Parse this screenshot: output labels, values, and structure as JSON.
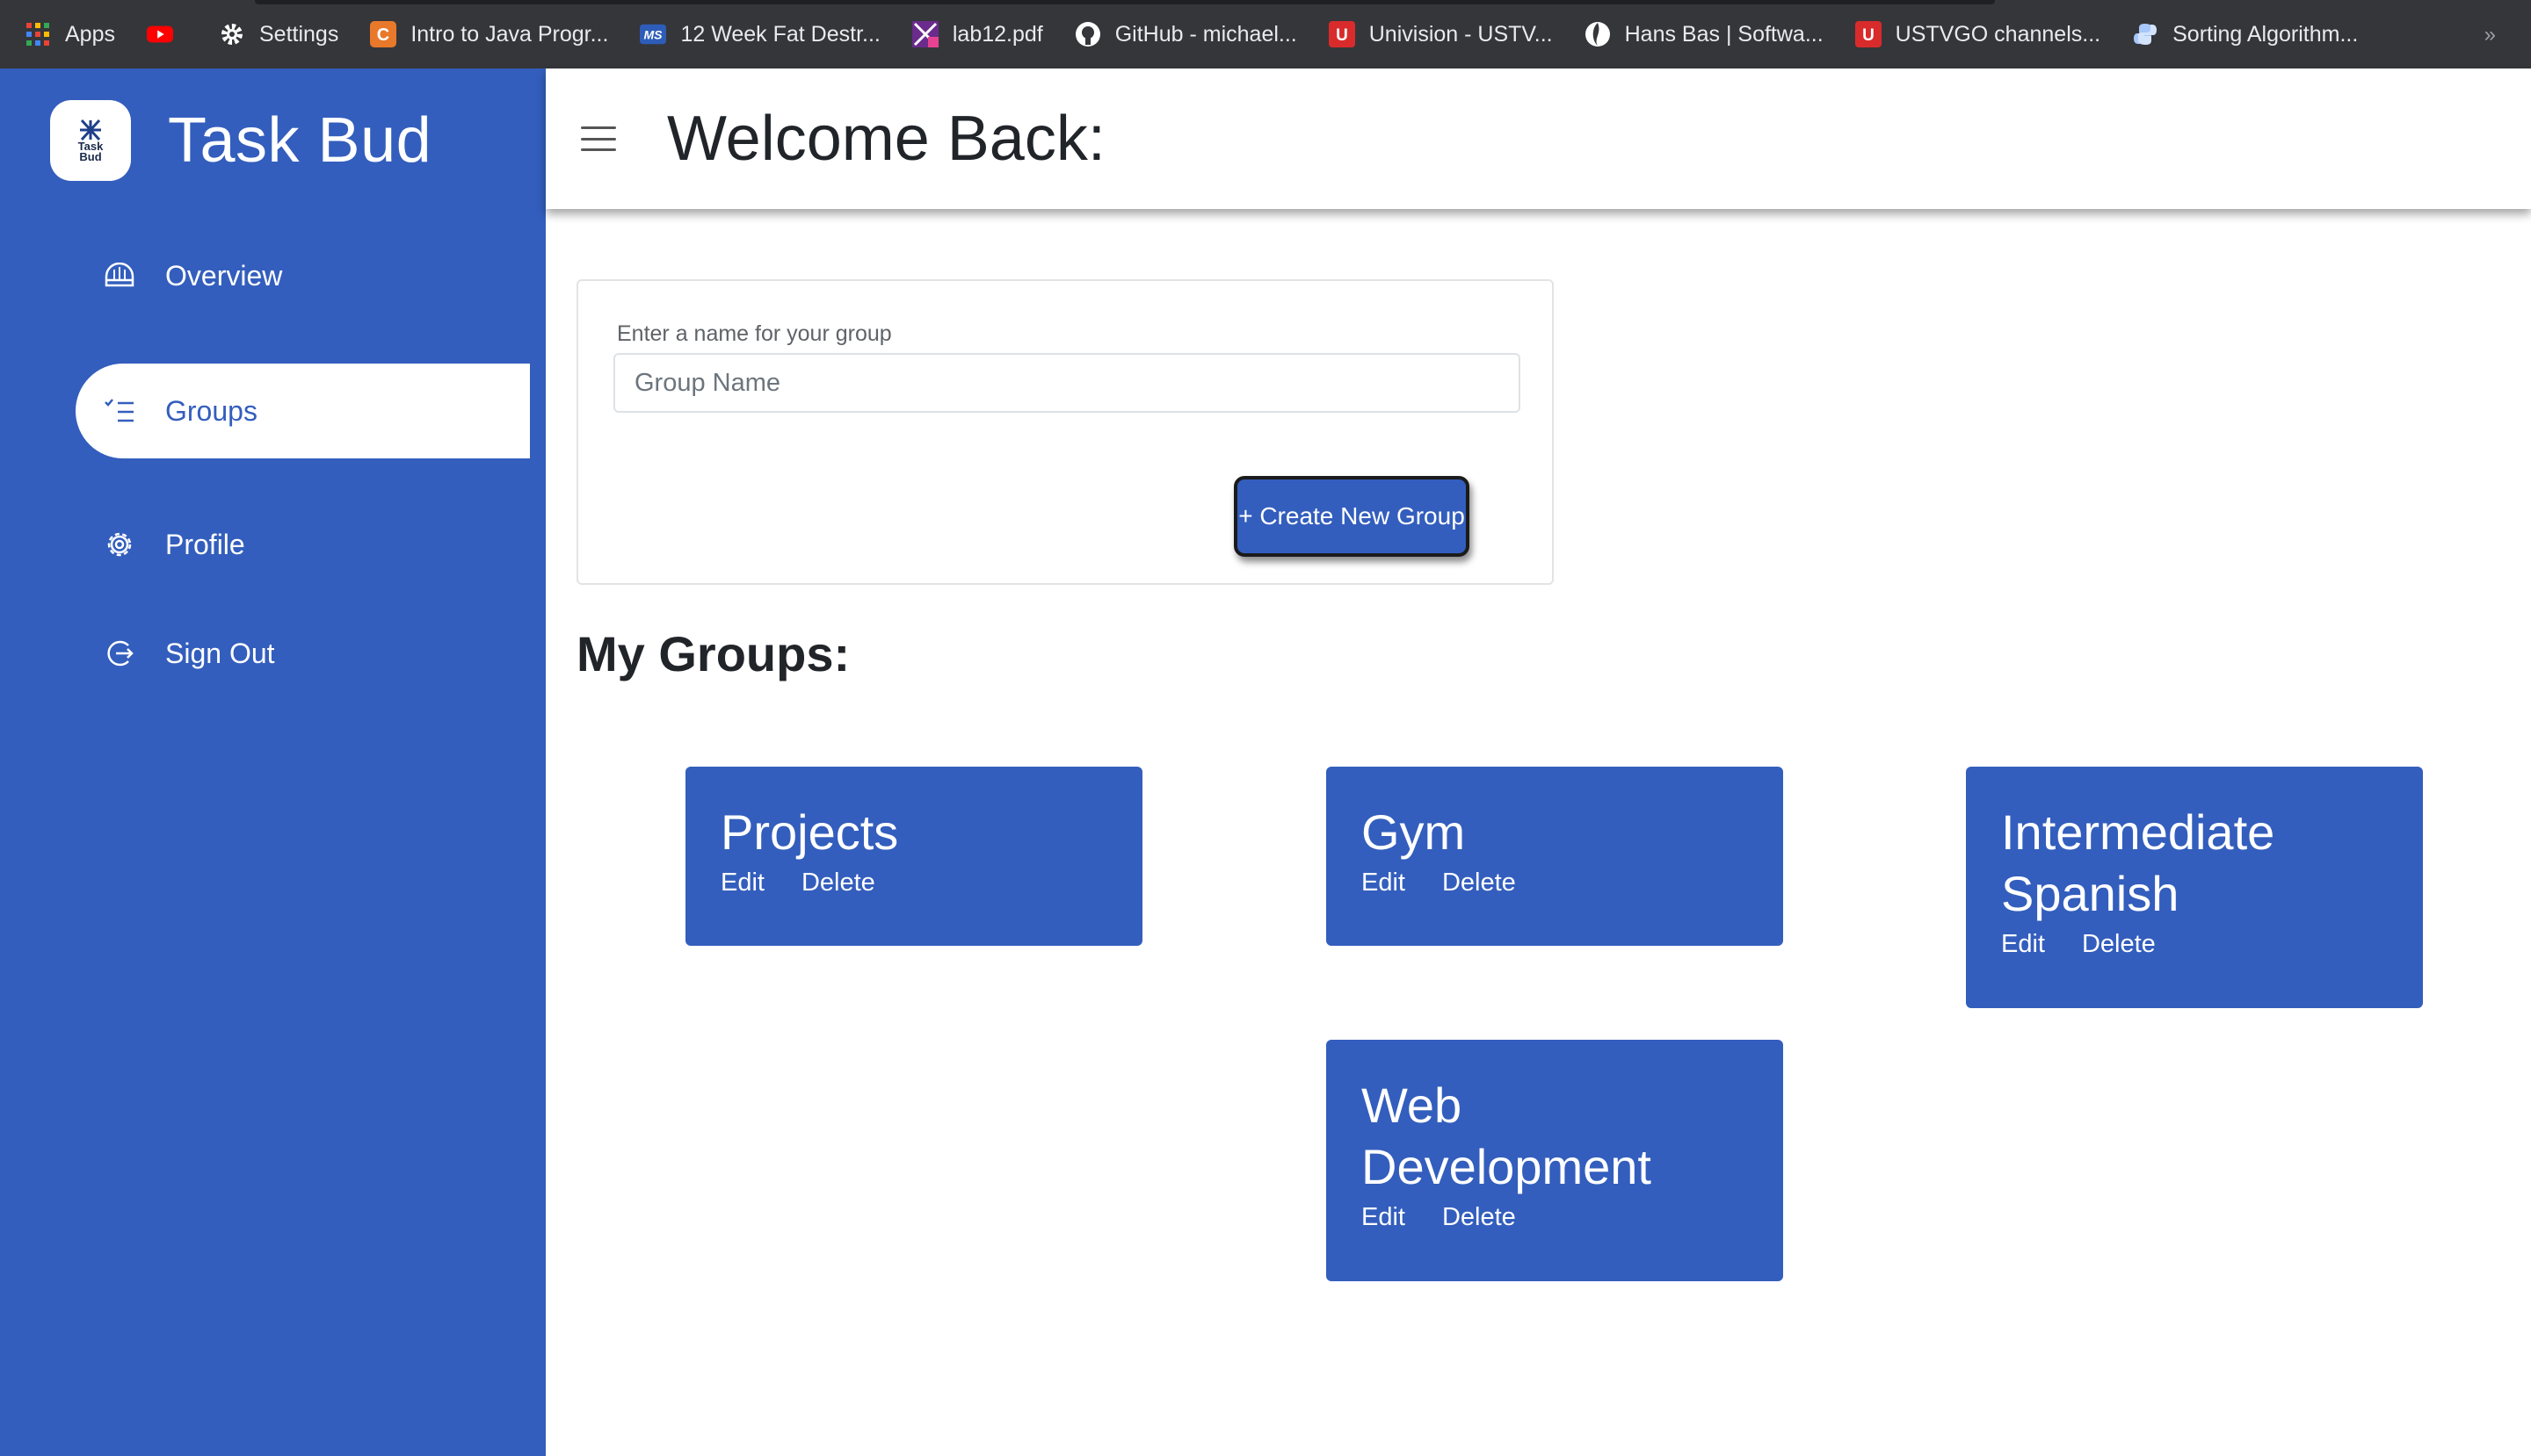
{
  "bookmarks": [
    {
      "label": "Apps",
      "icon": "apps-grid-icon"
    },
    {
      "label": "",
      "icon": "youtube-icon"
    },
    {
      "label": "Settings",
      "icon": "gear-icon"
    },
    {
      "label": "Intro to Java Progr...",
      "icon": "codecademy-icon"
    },
    {
      "label": "12 Week Fat Destr...",
      "icon": "ms-icon"
    },
    {
      "label": "lab12.pdf",
      "icon": "pdf-icon"
    },
    {
      "label": "GitHub - michael...",
      "icon": "github-icon"
    },
    {
      "label": "Univision - USTV...",
      "icon": "ustv-icon"
    },
    {
      "label": "Hans Bas | Softwa...",
      "icon": "globe-icon"
    },
    {
      "label": "USTVGO channels...",
      "icon": "ustv-icon"
    },
    {
      "label": "Sorting Algorithm...",
      "icon": "python-icon"
    }
  ],
  "bookmarks_more": "»",
  "brand": {
    "logo_line1": "Task",
    "logo_line2": "Bud",
    "name": "Task Bud"
  },
  "nav": {
    "overview": "Overview",
    "groups": "Groups",
    "profile": "Profile",
    "signout": "Sign Out"
  },
  "header": {
    "title": "Welcome Back:"
  },
  "form": {
    "label": "Enter a name for your group",
    "placeholder": "Group Name",
    "value": "",
    "button": "+ Create New Group"
  },
  "my_groups_title": "My Groups:",
  "groups": [
    {
      "name": "Projects",
      "edit": "Edit",
      "delete": "Delete"
    },
    {
      "name": "Gym",
      "edit": "Edit",
      "delete": "Delete"
    },
    {
      "name": "Intermediate Spanish",
      "edit": "Edit",
      "delete": "Delete"
    },
    {
      "name": "Web Development",
      "edit": "Edit",
      "delete": "Delete"
    }
  ],
  "colors": {
    "primary": "#335ebd",
    "bookmarks_bg": "#35363a"
  }
}
